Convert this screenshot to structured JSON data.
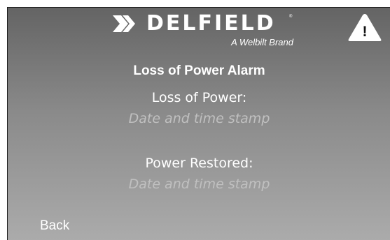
{
  "brand": {
    "name": "DELFIELD",
    "registered_mark": "®",
    "tagline": "A Welbilt Brand",
    "logo_icon": "delfield-chevron-logo"
  },
  "alarm_indicator": {
    "icon": "warning-triangle-icon",
    "symbol": "!"
  },
  "screen": {
    "title": "Loss of Power Alarm",
    "loss_of_power_label": "Loss of Power:",
    "loss_of_power_stamp": "Date and time stamp",
    "power_restored_label": "Power Restored:",
    "power_restored_stamp": "Date and time stamp"
  },
  "nav": {
    "back_label": "Back"
  },
  "colors": {
    "background_top": "#646464",
    "background_bottom": "#ababab",
    "text_primary": "#ffffff",
    "text_placeholder": "#c0c0c0"
  }
}
